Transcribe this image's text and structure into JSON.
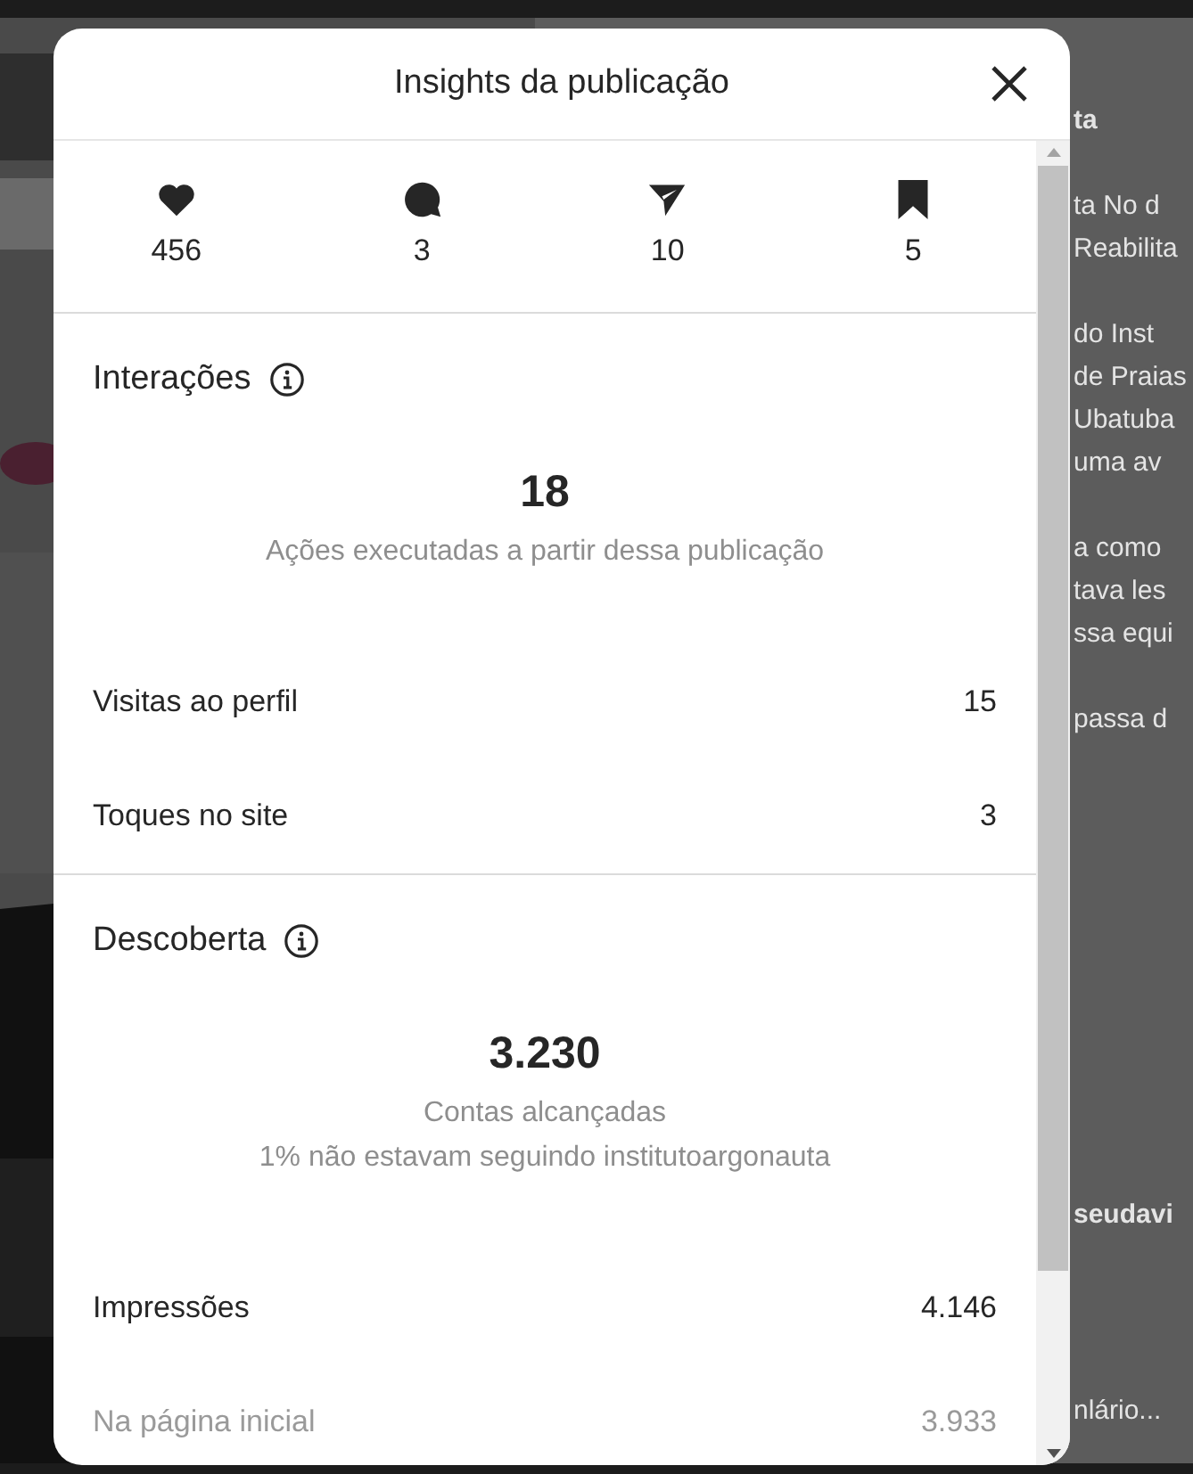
{
  "background": {
    "paragraphs": [
      [
        {
          "text": "ta",
          "bold": true
        }
      ],
      [
        {
          "text": "ta No d",
          "bold": false
        },
        {
          "text": "Reabilita",
          "bold": false
        }
      ],
      [
        {
          "text": "do Inst",
          "bold": false
        },
        {
          "text": "de Praias",
          "bold": false
        },
        {
          "text": "Ubatuba",
          "bold": false
        },
        {
          "text": "uma av",
          "bold": false
        }
      ],
      [
        {
          "text": "a como",
          "bold": false
        },
        {
          "text": "tava les",
          "bold": false
        },
        {
          "text": "ssa equi",
          "bold": false
        }
      ],
      [
        {
          "text": "passa d",
          "bold": false
        }
      ]
    ],
    "lower_lines": [
      {
        "text": "seudavi",
        "bold": true
      },
      {
        "text": "nlário...",
        "bold": false
      }
    ]
  },
  "modal": {
    "title": "Insights da publicação",
    "stats": [
      {
        "kind": "heart",
        "value": "456"
      },
      {
        "kind": "comment",
        "value": "3"
      },
      {
        "kind": "send",
        "value": "10"
      },
      {
        "kind": "bookmark",
        "value": "5"
      }
    ],
    "sections": [
      {
        "title": "Interações",
        "headline": "18",
        "captions": [
          "Ações executadas a partir dessa publicação"
        ],
        "rows": [
          {
            "label": "Visitas ao perfil",
            "value": "15",
            "secondary": false
          },
          {
            "label": "Toques no site",
            "value": "3",
            "secondary": false
          }
        ]
      },
      {
        "title": "Descoberta",
        "headline": "3.230",
        "captions": [
          "Contas alcançadas",
          "1% não estavam seguindo institutoargonauta"
        ],
        "rows": [
          {
            "label": "Impressões",
            "value": "4.146",
            "secondary": false
          },
          {
            "label": "Na página inicial",
            "value": "3.933",
            "secondary": true
          }
        ]
      }
    ]
  }
}
